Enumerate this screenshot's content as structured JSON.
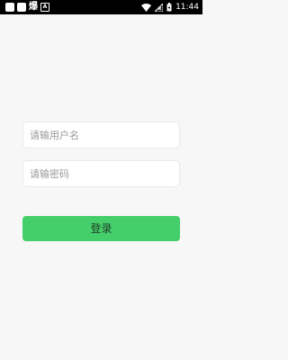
{
  "status_bar": {
    "left_glyph": "爆",
    "badge": "A",
    "time": "11:44"
  },
  "login": {
    "username_placeholder": "请输用户名",
    "password_placeholder": "请输密码",
    "submit_label": "登录"
  },
  "colors": {
    "background": "#f7f7f7",
    "accent": "#45cf6a",
    "status_bar": "#000000"
  }
}
